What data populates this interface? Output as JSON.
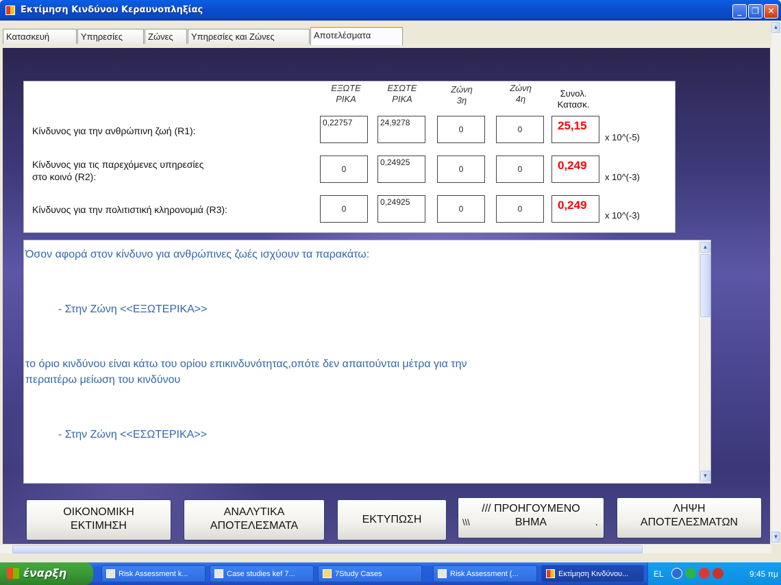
{
  "window": {
    "title": "Εκτίμηση Κινδύνου Κεραυνοπληξίας",
    "minimize": "_",
    "maximize": "❐",
    "close": "✕"
  },
  "tabs": [
    "Κατασκευή",
    "Υπηρεσίες",
    "Ζώνες",
    "Υπηρεσίες και Ζώνες",
    "Αποτελέσματα"
  ],
  "results": {
    "columns": [
      {
        "l1": "ΕΞΩΤΕ",
        "l2": "ΡΙΚΑ"
      },
      {
        "l1": "ΕΣΩΤΕ",
        "l2": "ΡΙΚΑ"
      },
      {
        "l1": "Ζώνη",
        "l2": "3η"
      },
      {
        "l1": "Ζώνη",
        "l2": "4η"
      },
      {
        "l1": "Συνολ.",
        "l2": "Κατασκ."
      }
    ],
    "rows": [
      {
        "label1": "Κίνδυνος για την ανθρώπινη ζωή (R1):",
        "label2": "",
        "v1": "0,22757",
        "v2": "24,9278",
        "v3": "0",
        "v4": "0",
        "total": "25,15",
        "unit": "x 10^(-5)"
      },
      {
        "label1": "Κίνδυνος για τις παρεχόμενες υπηρεσίες",
        "label2": "στο κοινό (R2):",
        "v1": "0",
        "v2": "0,24925",
        "v3": "0",
        "v4": "0",
        "total": "0,249",
        "unit": "x 10^(-3)"
      },
      {
        "label1": "Κίνδυνος για την πολιτιστική κληρονομιά (R3):",
        "label2": "",
        "v1": "0",
        "v2": "0,24925",
        "v3": "0",
        "v4": "0",
        "total": "0,249",
        "unit": "x 10^(-3)"
      }
    ]
  },
  "report": {
    "lines": [
      "Όσον αφορά στον κίνδυνο για ανθρώπινες ζωές ισχύουν τα παρακάτω:",
      "- Στην Ζώνη <<ΕΞΩΤΕΡΙΚΑ>>",
      "το όριο κινδύνου  είναι κάτω του ορίου επικινδυνότητας,οπότε δεν απαιτούνται μέτρα για την",
      "περαιτέρω μείωση του κινδύνου",
      "- Στην Ζώνη <<ΕΣΩΤΕΡΙΚΑ>>"
    ]
  },
  "buttons": {
    "economic": {
      "l1": "ΟΙΚΟΝΟΜΙΚΗ",
      "l2": "ΕΚΤΙΜΗΣΗ"
    },
    "analytic": {
      "l1": "ΑΝΑΛΥΤΙΚΑ",
      "l2": "ΑΠΟΤΕΛΕΣΜΑΤΑ"
    },
    "print": "ΕΚΤΥΠΩΣΗ",
    "previous": {
      "l1": "/// ΠΡΟΗΓΟΥΜΕΝΟ",
      "l2a": "\\\\\\",
      "l2b": "ΒΗΜΑ",
      "l2c": "."
    },
    "download": {
      "l1": "ΛΗΨΗ",
      "l2": "ΑΠΟΤΕΛΕΣΜΑΤΩΝ"
    }
  },
  "taskbar": {
    "start": "έναρξη",
    "tasks": [
      "Risk Assessment  k...",
      "Case studies kef 7...",
      "7Study Cases",
      "Risk Assessment (...",
      "Εκτίμηση Κινδύνου..."
    ],
    "lang": "EL",
    "clock": "9:45 πμ"
  }
}
